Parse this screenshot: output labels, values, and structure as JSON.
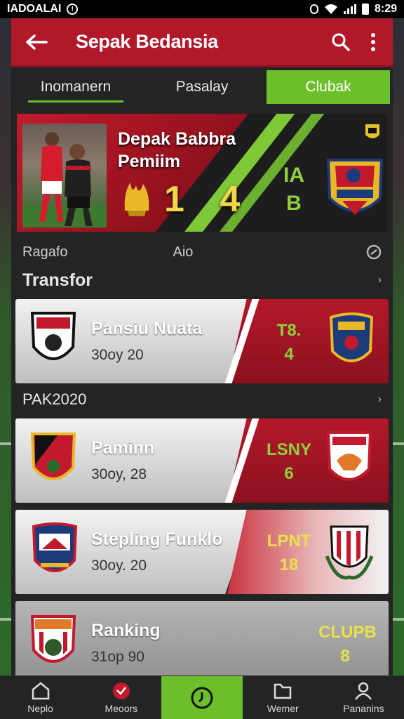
{
  "status_bar": {
    "carrier": "IADOALAI",
    "time": "8:29"
  },
  "app_bar": {
    "title": "Sepak Bedansia"
  },
  "tabs": [
    {
      "label": "Inomanern",
      "active": false
    },
    {
      "label": "Pasalay",
      "active": false
    },
    {
      "label": "Clubak",
      "active": true
    }
  ],
  "hero": {
    "title_line1": "Depak Babbra",
    "title_line2": "Pemiim",
    "score_home": "1",
    "score_away": "4",
    "side_top": "IA",
    "side_bottom": "B"
  },
  "filter_row": {
    "left": "Ragafo",
    "middle": "Aio"
  },
  "sections": {
    "transfer": {
      "title": "Transfor"
    },
    "pak": {
      "title": "PAK2020"
    }
  },
  "cards": [
    {
      "name": "Pansiu Nuata",
      "date": "30oy 20",
      "stat_top": "T8.",
      "stat_bottom": "4"
    },
    {
      "name": "Paminn",
      "date": "30oy, 28",
      "stat_top": "LSNY",
      "stat_bottom": "6"
    },
    {
      "name": "Stepling Funklo",
      "date": "30oy. 20",
      "stat_top": "LPNT",
      "stat_bottom": "18"
    },
    {
      "name": "Ranking",
      "date": "31op 90",
      "stat_top": "CLUPB",
      "stat_bottom": "8"
    }
  ],
  "bottom_nav": [
    {
      "label": "Neplo",
      "icon": "home-icon"
    },
    {
      "label": "Meoors",
      "icon": "heart-icon"
    },
    {
      "label": "",
      "icon": "clock-icon",
      "active": true
    },
    {
      "label": "Wemer",
      "icon": "folder-icon"
    },
    {
      "label": "Pananins",
      "icon": "person-icon"
    }
  ],
  "colors": {
    "brand_red": "#b1182a",
    "accent_green": "#6cbf2a",
    "score_yellow": "#f2d64a"
  }
}
